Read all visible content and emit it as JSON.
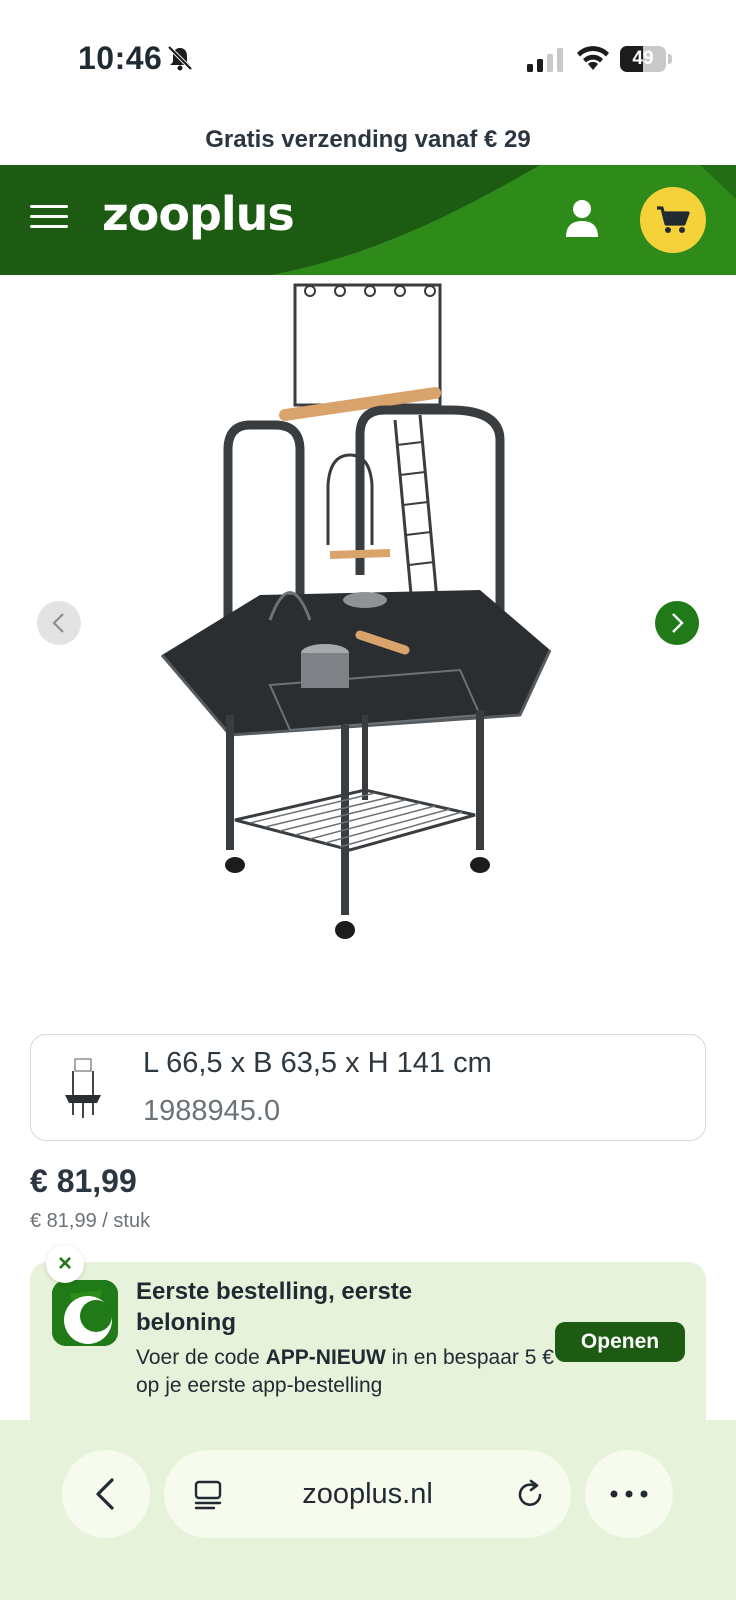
{
  "status_bar": {
    "time": "10:46",
    "battery": "49",
    "battery_level": 0.49
  },
  "promo": {
    "text": "Gratis verzending vanaf € 29"
  },
  "header": {
    "logo": "zooplus"
  },
  "product": {
    "variant_size": "L 66,5 x B 63,5 x H 141 cm",
    "variant_sku": "1988945.0",
    "price": "€ 81,99",
    "unit_price": "€ 81,99 / stuk"
  },
  "app_promo": {
    "close": "×",
    "title": "Eerste bestelling, eerste beloning",
    "text_before": "Voer de code ",
    "code": "APP-NIEUW",
    "text_after": " in en bespaar 5 € op je eerste app-bestelling",
    "button": "Openen"
  },
  "browser": {
    "url": "zooplus.nl"
  },
  "colors": {
    "brand_green": "#1d5a12",
    "accent_green": "#1f7a17",
    "cart_yellow": "#f6d23a",
    "promo_bg": "#e7f2da"
  }
}
